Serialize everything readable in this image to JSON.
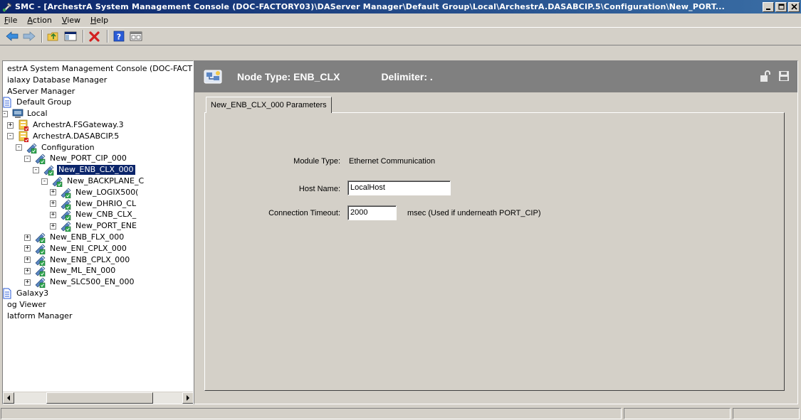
{
  "window": {
    "title": "SMC - [ArchestrA System Management Console (DOC-FACTORY03)\\DAServer Manager\\Default Group\\Local\\ArchestrA.DASABCIP.5\\Configuration\\New_PORT..."
  },
  "menu": [
    {
      "label": "File",
      "accel": "F",
      "rest": "ile"
    },
    {
      "label": "Action",
      "accel": "A",
      "rest": "ction"
    },
    {
      "label": "View",
      "accel": "V",
      "rest": "iew"
    },
    {
      "label": "Help",
      "accel": "H",
      "rest": "elp"
    }
  ],
  "toolbar": {
    "icons": [
      "back-arrow-icon",
      "forward-arrow-icon",
      "up-folder-icon",
      "show-hide-tree-icon",
      "delete-icon",
      "help-icon",
      "properties-icon"
    ]
  },
  "tree": {
    "items": [
      {
        "label": "estrA System Management Console (DOC-FACT",
        "icon": "",
        "expander": ""
      },
      {
        "label": "ialaxy Database Manager",
        "icon": "",
        "expander": ""
      },
      {
        "label": "AServer Manager",
        "icon": "",
        "expander": ""
      },
      {
        "label": "Default Group",
        "icon": "document-icon",
        "expander": ""
      },
      {
        "label": "Local",
        "icon": "computer-icon",
        "expander": "-"
      },
      {
        "label": "ArchestrA.FSGateway.3",
        "icon": "server-icon",
        "expander": "+"
      },
      {
        "label": "ArchestrA.DASABCIP.5",
        "icon": "server-icon",
        "expander": "-"
      },
      {
        "label": "Configuration",
        "icon": "config-icon",
        "expander": "-"
      },
      {
        "label": "New_PORT_CIP_000",
        "icon": "config-icon",
        "expander": "-"
      },
      {
        "label": "New_ENB_CLX_000",
        "icon": "config-icon",
        "expander": "-",
        "selected": true
      },
      {
        "label": "New_BACKPLANE_C",
        "icon": "config-icon",
        "expander": "-"
      },
      {
        "label": "New_LOGIX500(",
        "icon": "config-icon",
        "expander": "+"
      },
      {
        "label": "New_DHRIO_CL",
        "icon": "config-icon",
        "expander": "+"
      },
      {
        "label": "New_CNB_CLX_",
        "icon": "config-icon",
        "expander": "+"
      },
      {
        "label": "New_PORT_ENE",
        "icon": "config-icon",
        "expander": "+"
      },
      {
        "label": "New_ENB_FLX_000",
        "icon": "config-icon",
        "expander": "+"
      },
      {
        "label": "New_ENI_CPLX_000",
        "icon": "config-icon",
        "expander": "+"
      },
      {
        "label": "New_ENB_CPLX_000",
        "icon": "config-icon",
        "expander": "+"
      },
      {
        "label": "New_ML_EN_000",
        "icon": "config-icon",
        "expander": "+"
      },
      {
        "label": "New_SLC500_EN_000",
        "icon": "config-icon",
        "expander": "+"
      },
      {
        "label": "Galaxy3",
        "icon": "document-icon",
        "expander": ""
      },
      {
        "label": "og Viewer",
        "icon": "",
        "expander": ""
      },
      {
        "label": "latform Manager",
        "icon": "",
        "expander": ""
      }
    ]
  },
  "header": {
    "node_type": "Node Type: ENB_CLX",
    "delimiter": "Delimiter: ."
  },
  "tab": {
    "label": "New_ENB_CLX_000 Parameters"
  },
  "form": {
    "module_type_label": "Module Type:",
    "module_type_value": "Ethernet Communication",
    "host_name_label": "Host Name:",
    "host_name_value": "LocalHost",
    "timeout_label": "Connection Timeout:",
    "timeout_value": "2000",
    "timeout_unit": "msec  (Used if underneath PORT_CIP)"
  }
}
